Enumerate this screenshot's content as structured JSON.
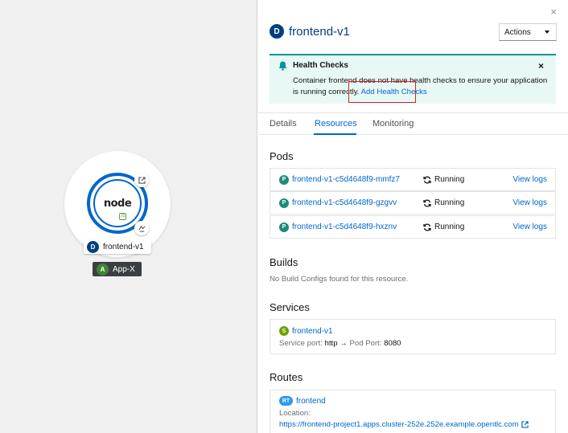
{
  "topology": {
    "node_logo_text": "node",
    "node_logo_sub": "JS",
    "node_label_badge": "D",
    "node_label": "frontend-v1",
    "app_badge": "A",
    "app_label": "App-X"
  },
  "panel": {
    "close_icon": "×",
    "title_badge": "D",
    "title": "frontend-v1",
    "actions_label": "Actions",
    "alert": {
      "title": "Health Checks",
      "body": "Container frontend does not have health checks to ensure your application is running correctly.",
      "link": "Add Health Checks",
      "close_icon": "×"
    },
    "tabs": [
      {
        "label": "Details"
      },
      {
        "label": "Resources"
      },
      {
        "label": "Monitoring"
      }
    ],
    "active_tab": "Resources",
    "pods": {
      "title": "Pods",
      "items": [
        {
          "badge": "P",
          "name": "frontend-v1-c5d4648f9-mmfz7",
          "status": "Running",
          "logs": "View logs"
        },
        {
          "badge": "P",
          "name": "frontend-v1-c5d4648f9-gzgvv",
          "status": "Running",
          "logs": "View logs"
        },
        {
          "badge": "P",
          "name": "frontend-v1-c5d4648f9-hxznv",
          "status": "Running",
          "logs": "View logs"
        }
      ]
    },
    "builds": {
      "title": "Builds",
      "empty": "No Build Configs found for this resource."
    },
    "services": {
      "title": "Services",
      "badge": "S",
      "name": "frontend-v1",
      "port_label": "Service port:",
      "port_value": "http",
      "arrow": "→",
      "pod_port_label": "Pod Port:",
      "pod_port_value": "8080"
    },
    "routes": {
      "title": "Routes",
      "badge": "RT",
      "name": "frontend",
      "location_label": "Location:",
      "url": "https://frontend-project1.apps.cluster-252e.252e.example.opentlc.com"
    }
  },
  "colors": {
    "link": "#0066cc",
    "deployment_badge": "#004080",
    "app_badge": "#3e8635",
    "alert_bg": "#e8f8f5",
    "highlight": "#e02020"
  }
}
